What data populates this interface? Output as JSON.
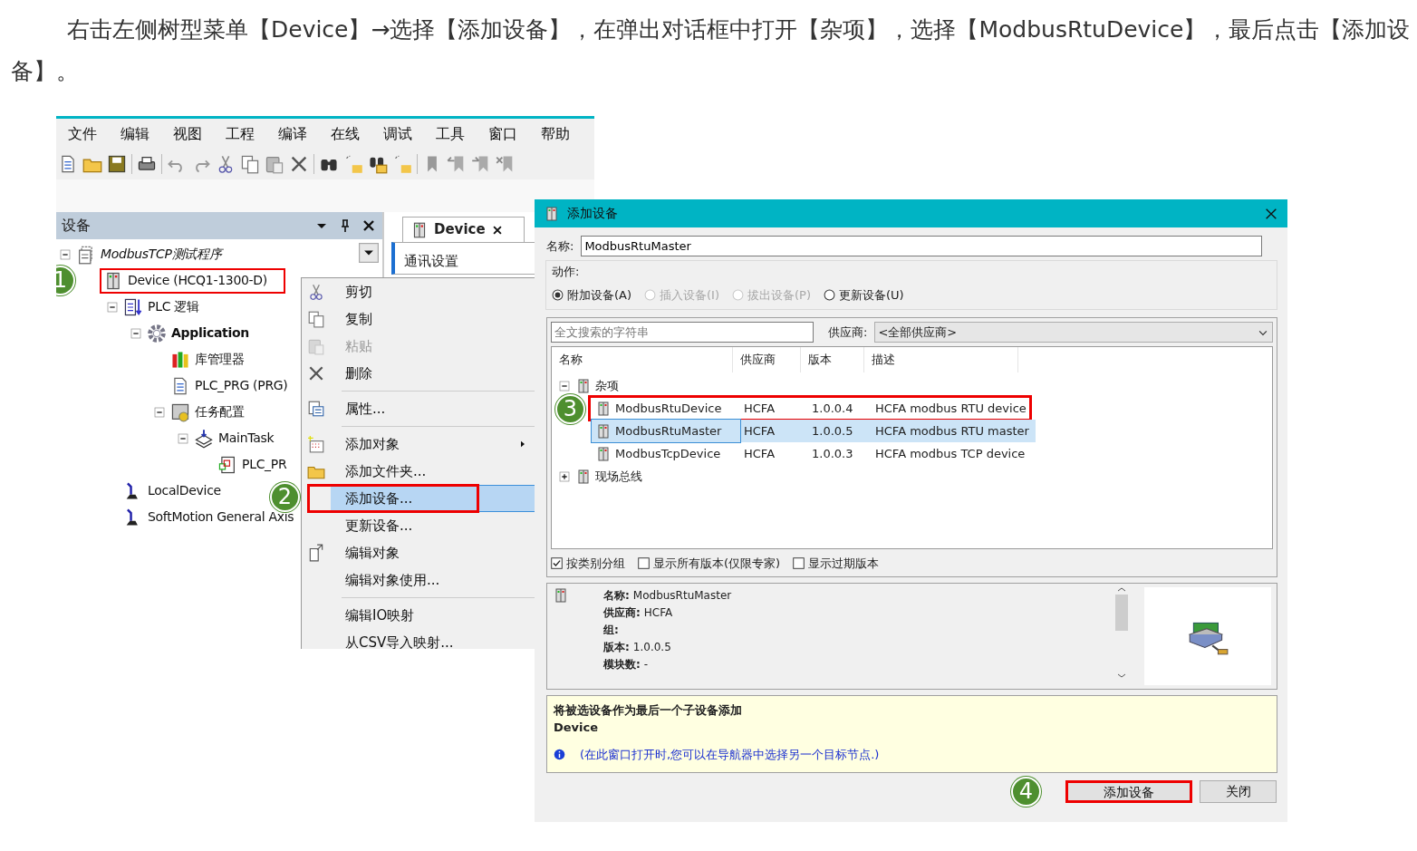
{
  "intro": "右击左侧树型菜单【Device】→选择【添加设备】，在弹出对话框中打开【杂项】，选择【ModbusRtuDevice】，最后点击【添加设备】。",
  "ide": {
    "menu": [
      "文件",
      "编辑",
      "视图",
      "工程",
      "编译",
      "在线",
      "调试",
      "工具",
      "窗口",
      "帮助"
    ],
    "devices_panel": {
      "title": "设备",
      "tree": [
        {
          "label": "ModbusTCP测试程序",
          "kind": "project",
          "expanded": true,
          "children": [
            {
              "label": "Device (HCQ1-1300-D)",
              "kind": "device",
              "highlighted": true,
              "callout": "1",
              "children": [
                {
                  "label": "PLC 逻辑",
                  "kind": "plc",
                  "expanded": true,
                  "children": [
                    {
                      "label": "Application",
                      "kind": "application",
                      "expanded": true,
                      "children": [
                        {
                          "label": "库管理器",
                          "kind": "library"
                        },
                        {
                          "label": "PLC_PRG (PRG)",
                          "kind": "pou"
                        },
                        {
                          "label": "任务配置",
                          "kind": "tasks",
                          "expanded": true,
                          "children": [
                            {
                              "label": "MainTask",
                              "kind": "task",
                              "expanded": true,
                              "children": [
                                {
                                  "label": "PLC_PR",
                                  "kind": "call"
                                }
                              ]
                            }
                          ]
                        }
                      ]
                    }
                  ]
                },
                {
                  "label": "LocalDevice",
                  "kind": "axis"
                },
                {
                  "label": "SoftMotion General Axis",
                  "kind": "axis"
                }
              ]
            }
          ]
        }
      ]
    },
    "editor": {
      "tab": "Device",
      "section": "通讯设置"
    },
    "context_menu": [
      {
        "kind": "item",
        "label": "剪切",
        "disabled": false,
        "selected": false,
        "submenu": false,
        "highlighted": false
      },
      {
        "kind": "item",
        "label": "复制",
        "disabled": false,
        "selected": false,
        "submenu": false,
        "highlighted": false
      },
      {
        "kind": "item",
        "label": "粘贴",
        "disabled": true,
        "selected": false,
        "submenu": false,
        "highlighted": false
      },
      {
        "kind": "item",
        "label": "删除",
        "disabled": false,
        "selected": false,
        "submenu": false,
        "highlighted": false
      },
      {
        "kind": "separator"
      },
      {
        "kind": "item",
        "label": "属性...",
        "disabled": false,
        "selected": false,
        "submenu": false,
        "highlighted": false
      },
      {
        "kind": "separator"
      },
      {
        "kind": "item",
        "label": "添加对象",
        "disabled": false,
        "selected": false,
        "submenu": true,
        "highlighted": false
      },
      {
        "kind": "item",
        "label": "添加文件夹...",
        "disabled": false,
        "selected": false,
        "submenu": false,
        "highlighted": false
      },
      {
        "kind": "item",
        "label": "添加设备...",
        "disabled": false,
        "selected": true,
        "submenu": false,
        "highlighted": true,
        "callout": "2"
      },
      {
        "kind": "item",
        "label": "更新设备...",
        "disabled": false,
        "selected": false,
        "submenu": false,
        "highlighted": false
      },
      {
        "kind": "item",
        "label": "编辑对象",
        "disabled": false,
        "selected": false,
        "submenu": false,
        "highlighted": false
      },
      {
        "kind": "item",
        "label": "编辑对象使用...",
        "disabled": false,
        "selected": false,
        "submenu": false,
        "highlighted": false
      },
      {
        "kind": "separator"
      },
      {
        "kind": "item",
        "label": "编辑IO映射",
        "disabled": false,
        "selected": false,
        "submenu": false,
        "highlighted": false
      },
      {
        "kind": "item",
        "label": "从CSV导入映射...",
        "disabled": false,
        "selected": false,
        "submenu": false,
        "highlighted": false
      }
    ]
  },
  "dialog": {
    "title": "添加设备",
    "name_label": "名称:",
    "name_value": "ModbusRtuMaster",
    "action_label": "动作:",
    "actions": [
      {
        "label": "附加设备(A)",
        "selected": true,
        "disabled": false
      },
      {
        "label": "插入设备(I)",
        "selected": false,
        "disabled": true
      },
      {
        "label": "拔出设备(P)",
        "selected": false,
        "disabled": true
      },
      {
        "label": "更新设备(U)",
        "selected": false,
        "disabled": false
      }
    ],
    "search_placeholder": "全文搜索的字符串",
    "vendor_label": "供应商:",
    "vendor_value": "<全部供应商>",
    "columns": [
      "名称",
      "供应商",
      "版本",
      "描述"
    ],
    "groups": [
      {
        "label": "杂项",
        "expanded": true,
        "devices": [
          {
            "cells": [
              "ModbusRtuDevice",
              "HCFA",
              "1.0.0.4",
              "HCFA modbus RTU device"
            ],
            "selected": false,
            "highlighted": true,
            "callout": "3"
          },
          {
            "cells": [
              "ModbusRtuMaster",
              "HCFA",
              "1.0.0.5",
              "HCFA modbus RTU master"
            ],
            "selected": true,
            "highlighted": false
          },
          {
            "cells": [
              "ModbusTcpDevice",
              "HCFA",
              "1.0.0.3",
              "HCFA modbus TCP device"
            ],
            "selected": false,
            "highlighted": false
          }
        ]
      },
      {
        "label": "现场总线",
        "expanded": false
      }
    ],
    "options": [
      {
        "label": "按类别分组",
        "checked": true
      },
      {
        "label": "显示所有版本(仅限专家)",
        "checked": false
      },
      {
        "label": "显示过期版本",
        "checked": false
      }
    ],
    "info": [
      {
        "label": "名称:",
        "value": "ModbusRtuMaster"
      },
      {
        "label": "供应商:",
        "value": "HCFA"
      },
      {
        "label": "组:"
      },
      {
        "label": "版本:",
        "value": "1.0.0.5"
      },
      {
        "label": "模块数:",
        "value": "-"
      }
    ],
    "message": {
      "title": "将被选设备作为最后一个子设备添加",
      "target": "Device",
      "note": "(在此窗口打开时,您可以在导航器中选择另一个目标节点.)"
    },
    "buttons": [
      {
        "label": "添加设备",
        "highlighted": true,
        "callout": "4"
      },
      {
        "label": "关闭",
        "highlighted": false
      }
    ]
  }
}
